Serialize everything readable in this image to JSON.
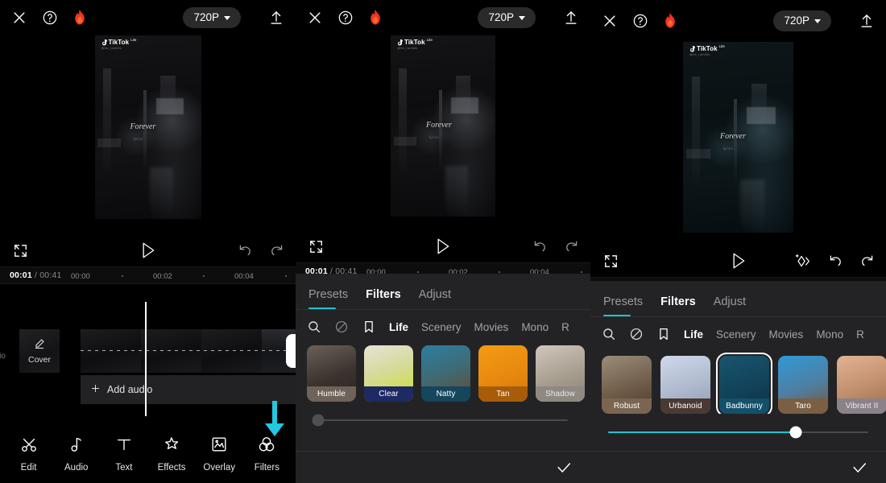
{
  "app": {
    "resolution_label": "720P",
    "accent_color": "#18c7cf",
    "annotation_arrow_color": "#22c9e0"
  },
  "topbar": {
    "close_icon": "close-icon",
    "help_icon": "help-circle-icon",
    "flame_icon": "flame-icon",
    "export_icon": "upload-icon",
    "resolution": "720P"
  },
  "preview": {
    "watermark_name": "TikTok",
    "watermark_suffix": "Lite",
    "watermark_handle": "@its_ramiiilo",
    "caption": "Forever",
    "caption_sub": "lyrics"
  },
  "playback": {
    "fullscreen_icon": "fullscreen-icon",
    "play_icon": "play-icon",
    "keyframe_icon": "keyframe-icon",
    "undo_icon": "undo-icon",
    "redo_icon": "redo-icon"
  },
  "ruler": {
    "current_time": "00:01",
    "separator": "/",
    "total_time": "00:41",
    "ticks": [
      "00:00",
      "00:02",
      "00:04"
    ]
  },
  "timeline": {
    "audio_ghost_label": "udio",
    "cover_label": "Cover",
    "cover_icon": "pencil-icon",
    "add_clip_label": "+",
    "add_audio_label": "Add audio",
    "add_audio_icon": "plus-icon"
  },
  "toolbar": {
    "items": [
      {
        "label": "Edit",
        "icon": "scissors-icon"
      },
      {
        "label": "Audio",
        "icon": "music-note-icon"
      },
      {
        "label": "Text",
        "icon": "text-t-icon"
      },
      {
        "label": "Effects",
        "icon": "sparkle-star-icon"
      },
      {
        "label": "Overlay",
        "icon": "picture-frame-icon"
      },
      {
        "label": "Filters",
        "icon": "three-circles-icon"
      }
    ]
  },
  "filter_sheet": {
    "tabs": [
      {
        "label": "Presets",
        "active": false
      },
      {
        "label": "Filters",
        "active": true
      },
      {
        "label": "Adjust",
        "active": false
      }
    ],
    "search_icon": "search-icon",
    "none_icon": "no-filter-icon",
    "bookmark_icon": "bookmark-icon",
    "categories": [
      {
        "label": "Life",
        "active": true
      },
      {
        "label": "Scenery",
        "active": false
      },
      {
        "label": "Movies",
        "active": false
      },
      {
        "label": "Mono",
        "active": false
      },
      {
        "label": "R",
        "active": false
      }
    ],
    "confirm_icon": "check-icon",
    "panel2": {
      "filters": [
        {
          "name": "Humble",
          "cap_color": "#6f6258",
          "img_from": "#6b6159",
          "img_to": "#2a2320",
          "selected": false
        },
        {
          "name": "Clear",
          "cap_color": "#1d2a63",
          "img_from": "#e6e3d8",
          "img_to": "#cfe02a",
          "selected": false
        },
        {
          "name": "Natty",
          "cap_color": "#14465c",
          "img_from": "#2d7ea0",
          "img_to": "#6b4530",
          "selected": false
        },
        {
          "name": "Tan",
          "cap_color": "#a85c0a",
          "img_from": "#f39b14",
          "img_to": "#d0760a",
          "selected": false
        },
        {
          "name": "Shadow",
          "cap_color": "#8e8a82",
          "img_from": "#cfc8bb",
          "img_to": "#8a8176",
          "selected": false
        },
        {
          "name": "",
          "cap_color": "#2b3a63",
          "img_from": "#3b5c8a",
          "img_to": "#1d2a4a",
          "selected": false
        }
      ],
      "slider_value": 0
    },
    "panel3": {
      "filters": [
        {
          "name": "Robust",
          "cap_color": "#7a6551",
          "img_from": "#9b8c7a",
          "img_to": "#4a3a2c",
          "selected": false
        },
        {
          "name": "Urbanoid",
          "cap_color": "#4a3a33",
          "img_from": "#cfd9ea",
          "img_to": "#8f9bb0",
          "selected": false
        },
        {
          "name": "Badbunny",
          "cap_color": "#14506b",
          "img_from": "#19556e",
          "img_to": "#0d2f41",
          "selected": true
        },
        {
          "name": "Taro",
          "cap_color": "#7a5f44",
          "img_from": "#2f9ad6",
          "img_to": "#7b5235",
          "selected": false
        },
        {
          "name": "Vibrant II",
          "cap_color": "#8b8189",
          "img_from": "#e3b391",
          "img_to": "#9a6b4a",
          "selected": false
        },
        {
          "name": "",
          "cap_color": "#3c4a33",
          "img_from": "#5d7a47",
          "img_to": "#2a3a22",
          "selected": false
        }
      ],
      "slider_value": 72
    }
  }
}
